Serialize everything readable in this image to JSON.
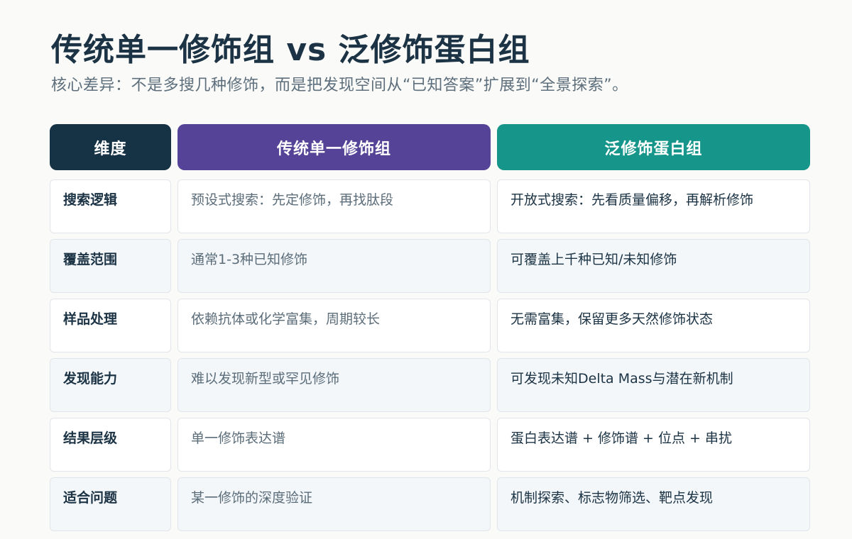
{
  "page": {
    "title": "传统单一修饰组 vs 泛修饰蛋白组",
    "subtitle": "核心差异：不是多搜几种修饰，而是把发现空间从“已知答案”扩展到“全景探索”。"
  },
  "table": {
    "headers": {
      "dimension": "维度",
      "traditional": "传统单一修饰组",
      "pan": "泛修饰蛋白组"
    },
    "rows": [
      {
        "dimension": "搜索逻辑",
        "traditional": "预设式搜索：先定修饰，再找肽段",
        "pan": "开放式搜索：先看质量偏移，再解析修饰"
      },
      {
        "dimension": "覆盖范围",
        "traditional": "通常1-3种已知修饰",
        "pan": "可覆盖上千种已知/未知修饰"
      },
      {
        "dimension": "样品处理",
        "traditional": "依赖抗体或化学富集，周期较长",
        "pan": "无需富集，保留更多天然修饰状态"
      },
      {
        "dimension": "发现能力",
        "traditional": "难以发现新型或罕见修饰",
        "pan": "可发现未知Delta Mass与潜在新机制"
      },
      {
        "dimension": "结果层级",
        "traditional": "单一修饰表达谱",
        "pan": "蛋白表达谱 + 修饰谱 + 位点 + 串扰"
      },
      {
        "dimension": "适合问题",
        "traditional": "某一修饰的深度验证",
        "pan": "机制探索、标志物筛选、靶点发现"
      }
    ]
  },
  "colors": {
    "header_dimension": "#163245",
    "header_traditional": "#544396",
    "header_pan": "#16968a",
    "title_text": "#1b3344",
    "muted_text": "#5c6d7a",
    "row_alt_bg": "#f3f7fa"
  }
}
